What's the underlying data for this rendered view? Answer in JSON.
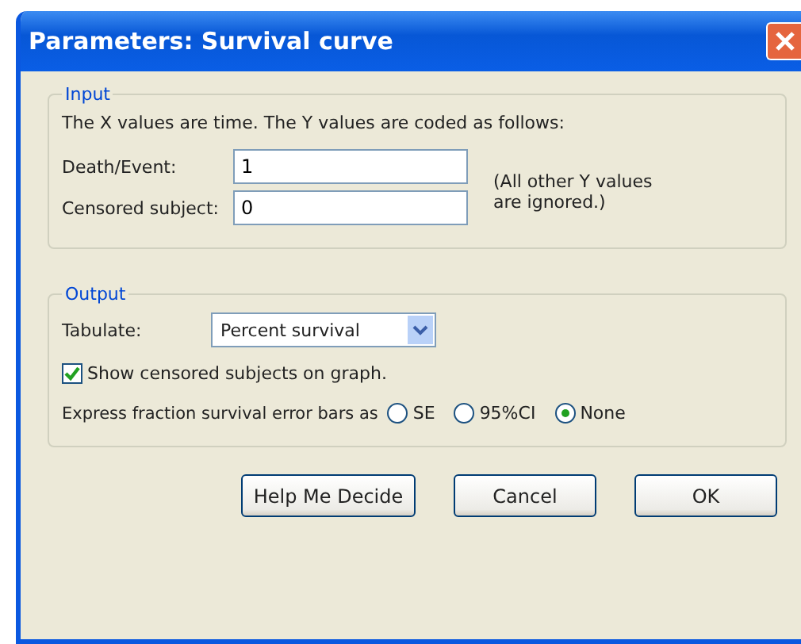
{
  "window": {
    "title": "Parameters: Survival curve"
  },
  "input": {
    "legend": "Input",
    "intro": "The X values are time. The Y values are coded as follows:",
    "fields": [
      {
        "label": "Death/Event:",
        "value": "1"
      },
      {
        "label": "Censored subject:",
        "value": "0"
      }
    ],
    "note": "(All other Y values are ignored.)"
  },
  "output": {
    "legend": "Output",
    "tabulate_label": "Tabulate:",
    "tabulate_value": "Percent survival",
    "show_censored": {
      "label": "Show censored subjects on graph.",
      "checked": true
    },
    "error_bars_label": "Express fraction survival error bars as",
    "error_bars": [
      {
        "label": "SE",
        "selected": false
      },
      {
        "label": "95%CI",
        "selected": false
      },
      {
        "label": "None",
        "selected": true
      }
    ]
  },
  "buttons": [
    "Help Me Decide",
    "Cancel",
    "OK"
  ]
}
